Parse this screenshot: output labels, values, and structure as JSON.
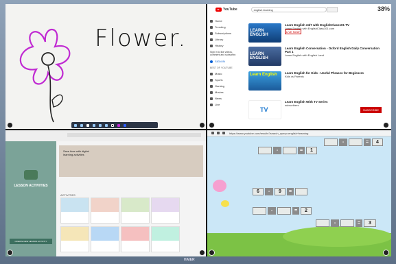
{
  "whiteboard": {
    "title_text": "Flower."
  },
  "youtube": {
    "brand": "YouTube",
    "search_value": "english learning",
    "sidebar": [
      "Home",
      "Trending",
      "Subscriptions",
      "Library",
      "History"
    ],
    "signin_text": "Sign in to like videos, comment and subscribe.",
    "signin_label": "SIGN IN",
    "best_of": "BEST OF YOUTUBE",
    "best_items": [
      "Music",
      "Sports",
      "Gaming",
      "Movies",
      "News",
      "Live"
    ],
    "results": [
      {
        "thumb_text": "LEARN ENGLISH",
        "title": "Learn English 24/7 with EnglishClass101 TV",
        "meta": "Learn English with EnglishClass101.com",
        "badge": "LIVE NOW"
      },
      {
        "thumb_text": "LEARN ENGLISH",
        "title": "Learn English Conversation - Oxford English Daily Conversation Part 1",
        "meta": "Learn English with English Land"
      },
      {
        "thumb_text": "Learn English",
        "title": "Learn English for Kids - Useful Phrases for Beginners",
        "meta": "Kids vs Parents"
      },
      {
        "thumb_text": "TV",
        "title": "Learn English With TV Series",
        "meta": "subscribers",
        "action": "SUBSCRIBE"
      }
    ]
  },
  "browser": {
    "url": "https://www.youtube.com/results?search_query=english+learning"
  },
  "lesson": {
    "side_title": "LESSON ACTIVITIES",
    "side_button": "CREATE NEW LESSON ACTIVITY",
    "banner_text": "Save time with digital learning activities",
    "section_label": "ACTIVITIES"
  },
  "game": {
    "row1": [
      "-",
      "=",
      "4"
    ],
    "row2": [
      "-",
      "=",
      "1"
    ],
    "row3": [
      "6",
      "-",
      "9",
      "="
    ],
    "row4": [
      "-",
      "=",
      "2"
    ],
    "row5": [
      "-",
      "=",
      "3"
    ]
  },
  "hud": {
    "battery": "38%"
  },
  "device_label": "HAIER"
}
